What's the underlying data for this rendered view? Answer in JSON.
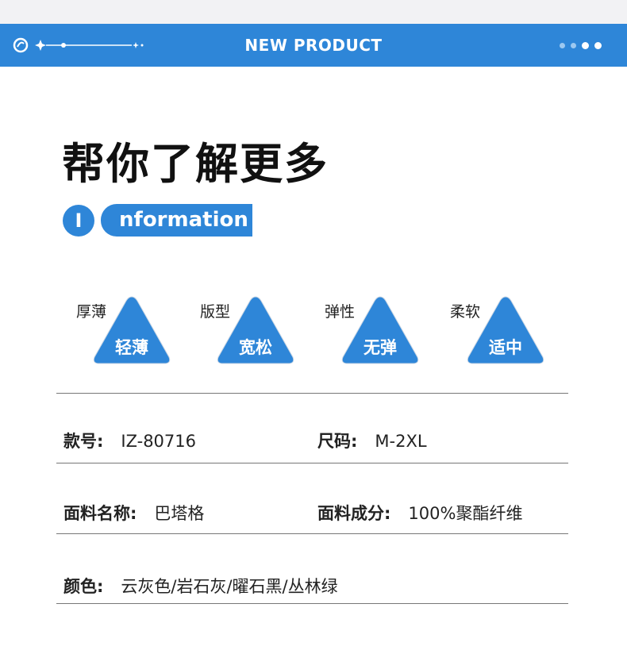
{
  "header": {
    "title": "NEW PRODUCT"
  },
  "main_title": "帮你了解更多",
  "info": {
    "badge_letter": "I",
    "word_rest": "nformation"
  },
  "attributes": [
    {
      "label": "厚薄",
      "value": "轻薄"
    },
    {
      "label": "版型",
      "value": "宽松"
    },
    {
      "label": "弹性",
      "value": "无弹"
    },
    {
      "label": "柔软",
      "value": "适中"
    }
  ],
  "specs": {
    "style_no": {
      "label": "款号:",
      "value": "IZ-80716"
    },
    "size": {
      "label": "尺码:",
      "value": "M-2XL"
    },
    "fabric_name": {
      "label": "面料名称:",
      "value": "巴塔格"
    },
    "fabric_composition": {
      "label": "面料成分:",
      "value": "100%聚酯纤维"
    },
    "color": {
      "label": "颜色:",
      "value": "云灰色/岩石灰/曜石黑/丛林绿"
    }
  },
  "colors": {
    "accent": "#2e86d8",
    "header_bg": "#2e86d8"
  }
}
